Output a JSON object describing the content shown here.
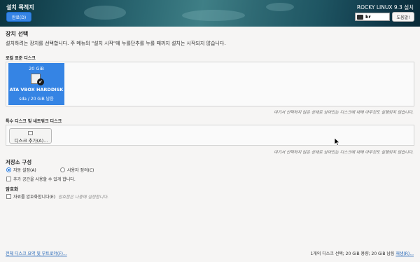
{
  "header": {
    "title": "설치 목적지",
    "done_label": "완료(D)",
    "product": "ROCKY LINUX 9.3 설치",
    "keyboard_layout": "kr",
    "help_label": "도움말!"
  },
  "device_selection": {
    "title": "장치 선택",
    "description": "설치하려는 장치를 선택합니다. 주 메뉴의 \"설치 시작\"에 누를단추를 누를 때까지 설치는 시작되지 않습니다."
  },
  "local_disks": {
    "label": "로컬 표준 디스크",
    "disks": [
      {
        "size": "20 GiB",
        "name": "ATA VBOX HARDDISK",
        "info": "sda   /   20 GiB 남음",
        "selected": true
      }
    ],
    "hint": "여기서 선택하지 않은 상태로 남아있는 디스크에 대해 아무것도 실행되지 않습니다."
  },
  "special_disks": {
    "label": "특수 디스크 및 네트워크 디스크",
    "add_label": "디스크 추가(A)...",
    "hint": "여기서 선택하지 않은 상태로 남아있는 디스크에 대해 아무것도 실행되지 않습니다."
  },
  "storage_config": {
    "title": "저장소 구성",
    "auto_label": "자동 설정(A)",
    "custom_label": "사용자 정의(C)",
    "selected": "auto",
    "extra_space_label": "추가 공간을 사용할 수 있게 합니다."
  },
  "encryption": {
    "title": "암호화",
    "encrypt_label": "자료를 암호화합니다(E)",
    "note": "암호문은 나중에 설정합니다."
  },
  "footer": {
    "summary_link": "전체 디스크 요약 및 부트로더(F)...",
    "status": "1개의 디스크 선택; 20 GiB 용량; 20 GiB 남음",
    "refresh_link": "재생(R)..."
  },
  "colors": {
    "accent": "#3584e4",
    "link": "#1a5fb4"
  }
}
